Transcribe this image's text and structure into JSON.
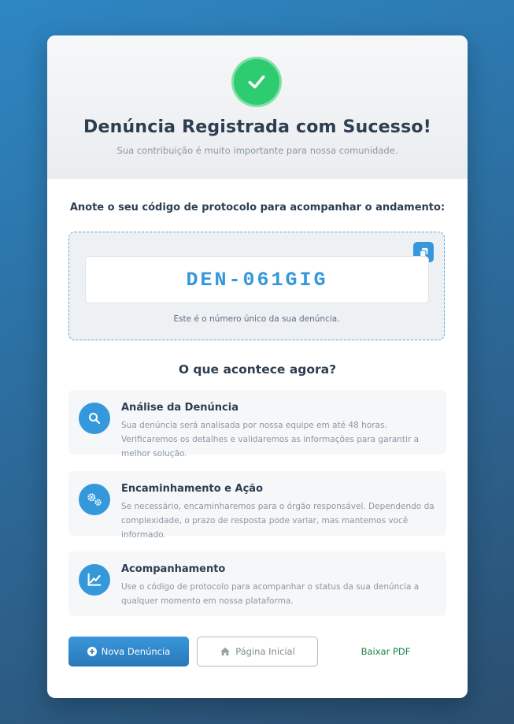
{
  "header": {
    "title": "Denúncia Registrada com Sucesso!",
    "subtitle": "Sua contribuição é muito importante para nossa comunidade."
  },
  "protocol": {
    "instruction": "Anote o seu código de protocolo para acompanhar o andamento:",
    "code": "DEN-061GIG",
    "note": "Este é o número único da sua denúncia.",
    "copy_icon": "copy-icon"
  },
  "next": {
    "title": "O que acontece agora?",
    "steps": [
      {
        "icon": "search-icon",
        "title": "Análise da Denúncia",
        "desc": "Sua denúncia será analisada por nossa equipe em até 48 horas. Verificaremos os detalhes e validaremos as informações para garantir a melhor solução."
      },
      {
        "icon": "cogs-icon",
        "title": "Encaminhamento e Ação",
        "desc": "Se necessário, encaminharemos para o órgão responsável. Dependendo da complexidade, o prazo de resposta pode variar, mas mantemos você informado."
      },
      {
        "icon": "chart-line-icon",
        "title": "Acompanhamento",
        "desc": "Use o código de protocolo para acompanhar o status da sua denúncia a qualquer momento em nossa plataforma."
      }
    ]
  },
  "actions": {
    "new_label": "Nova Denúncia",
    "home_label": "Página Inicial",
    "pdf_label": "Baixar PDF"
  },
  "colors": {
    "accent": "#3498db",
    "success": "#2ecc71",
    "link": "#1e8449"
  }
}
